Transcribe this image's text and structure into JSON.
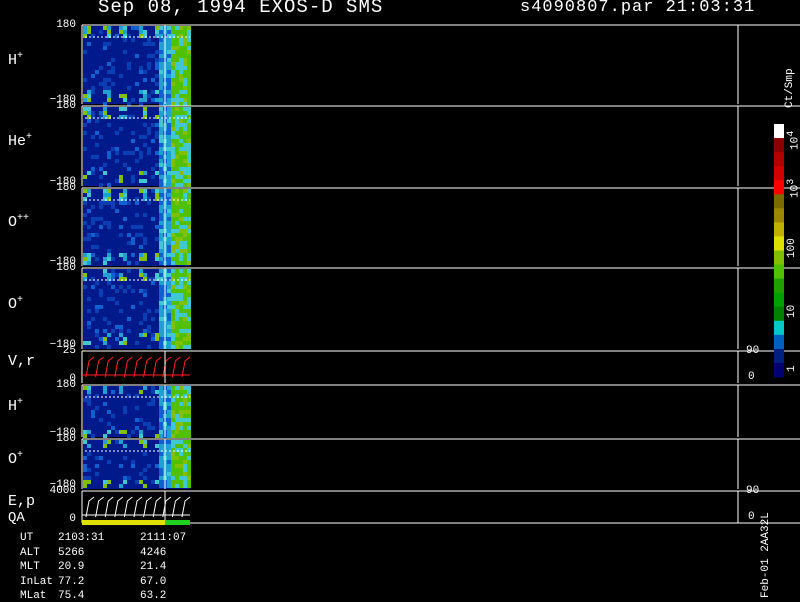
{
  "header": {
    "title": "Sep 08, 1994   EXOS-D SMS",
    "file": "s4090807.par  21:03:31"
  },
  "panels": [
    {
      "id": "h-plus",
      "base": "H",
      "sup": "+",
      "ymax": "180",
      "ymin": "−180",
      "kind": "spectrogram"
    },
    {
      "id": "he-plus",
      "base": "He",
      "sup": "+",
      "ymax": "180",
      "ymin": "−180",
      "kind": "spectrogram"
    },
    {
      "id": "o-plusplus",
      "base": "O",
      "sup": "++",
      "ymax": "180",
      "ymin": "−180",
      "kind": "spectrogram"
    },
    {
      "id": "o-plus",
      "base": "O",
      "sup": "+",
      "ymax": "180",
      "ymin": "−180",
      "kind": "spectrogram"
    },
    {
      "id": "vr",
      "base": "V,r",
      "sup": "",
      "ymax": "25",
      "ymin": "0",
      "rmax": "90",
      "rmin": "0",
      "kind": "line"
    },
    {
      "id": "h-plus-2",
      "base": "H",
      "sup": "+",
      "ymax": "180",
      "ymin": "−180",
      "kind": "spectrogram"
    },
    {
      "id": "o-plus-2",
      "base": "O",
      "sup": "+",
      "ymax": "180",
      "ymin": "−180",
      "kind": "spectrogram"
    },
    {
      "id": "ep",
      "base": "E,p",
      "sup": "",
      "ymax": "4000",
      "ymin": "0",
      "rmax": "90",
      "rmin": "0",
      "kind": "line"
    }
  ],
  "qa_label": "QA",
  "colorbar": {
    "unit": "Ct/Smp",
    "ticks": [
      {
        "base": "10",
        "sup": "4"
      },
      {
        "base": "10",
        "sup": "3"
      },
      {
        "base": "100",
        "sup": ""
      },
      {
        "base": "10",
        "sup": ""
      },
      {
        "base": "1",
        "sup": ""
      }
    ],
    "colors": [
      "#ffffff",
      "#8b0000",
      "#b00000",
      "#d00000",
      "#ff0000",
      "#7a6a00",
      "#9c8800",
      "#c2b000",
      "#e0e000",
      "#80c000",
      "#50c000",
      "#20a000",
      "#00a000",
      "#008000",
      "#00c8c8",
      "#0060c0",
      "#002080",
      "#000070"
    ]
  },
  "footer": {
    "rows": [
      {
        "label": "UT",
        "v1": "2103:31",
        "v2": "2111:07"
      },
      {
        "label": "ALT",
        "v1": "5266",
        "v2": "4246"
      },
      {
        "label": "MLT",
        "v1": "20.9",
        "v2": "21.4"
      },
      {
        "label": "InLat",
        "v1": "77.2",
        "v2": "67.0"
      },
      {
        "label": "MLat",
        "v1": "75.4",
        "v2": "63.2"
      }
    ],
    "side_note": "Feb-01 2AA32L"
  },
  "chart_data": {
    "type": "heatmap",
    "title": "Sep 08, 1994   EXOS-D SMS",
    "x": [
      "2103:31",
      "2111:07"
    ],
    "panels": [
      "H+",
      "He+",
      "O++",
      "O+",
      "V,r",
      "H+",
      "O+",
      "E,p"
    ],
    "ylim": [
      -180,
      180
    ],
    "color_scale": {
      "unit": "Ct/Smp",
      "log": true,
      "range": [
        1,
        10000
      ]
    },
    "grid": false
  }
}
